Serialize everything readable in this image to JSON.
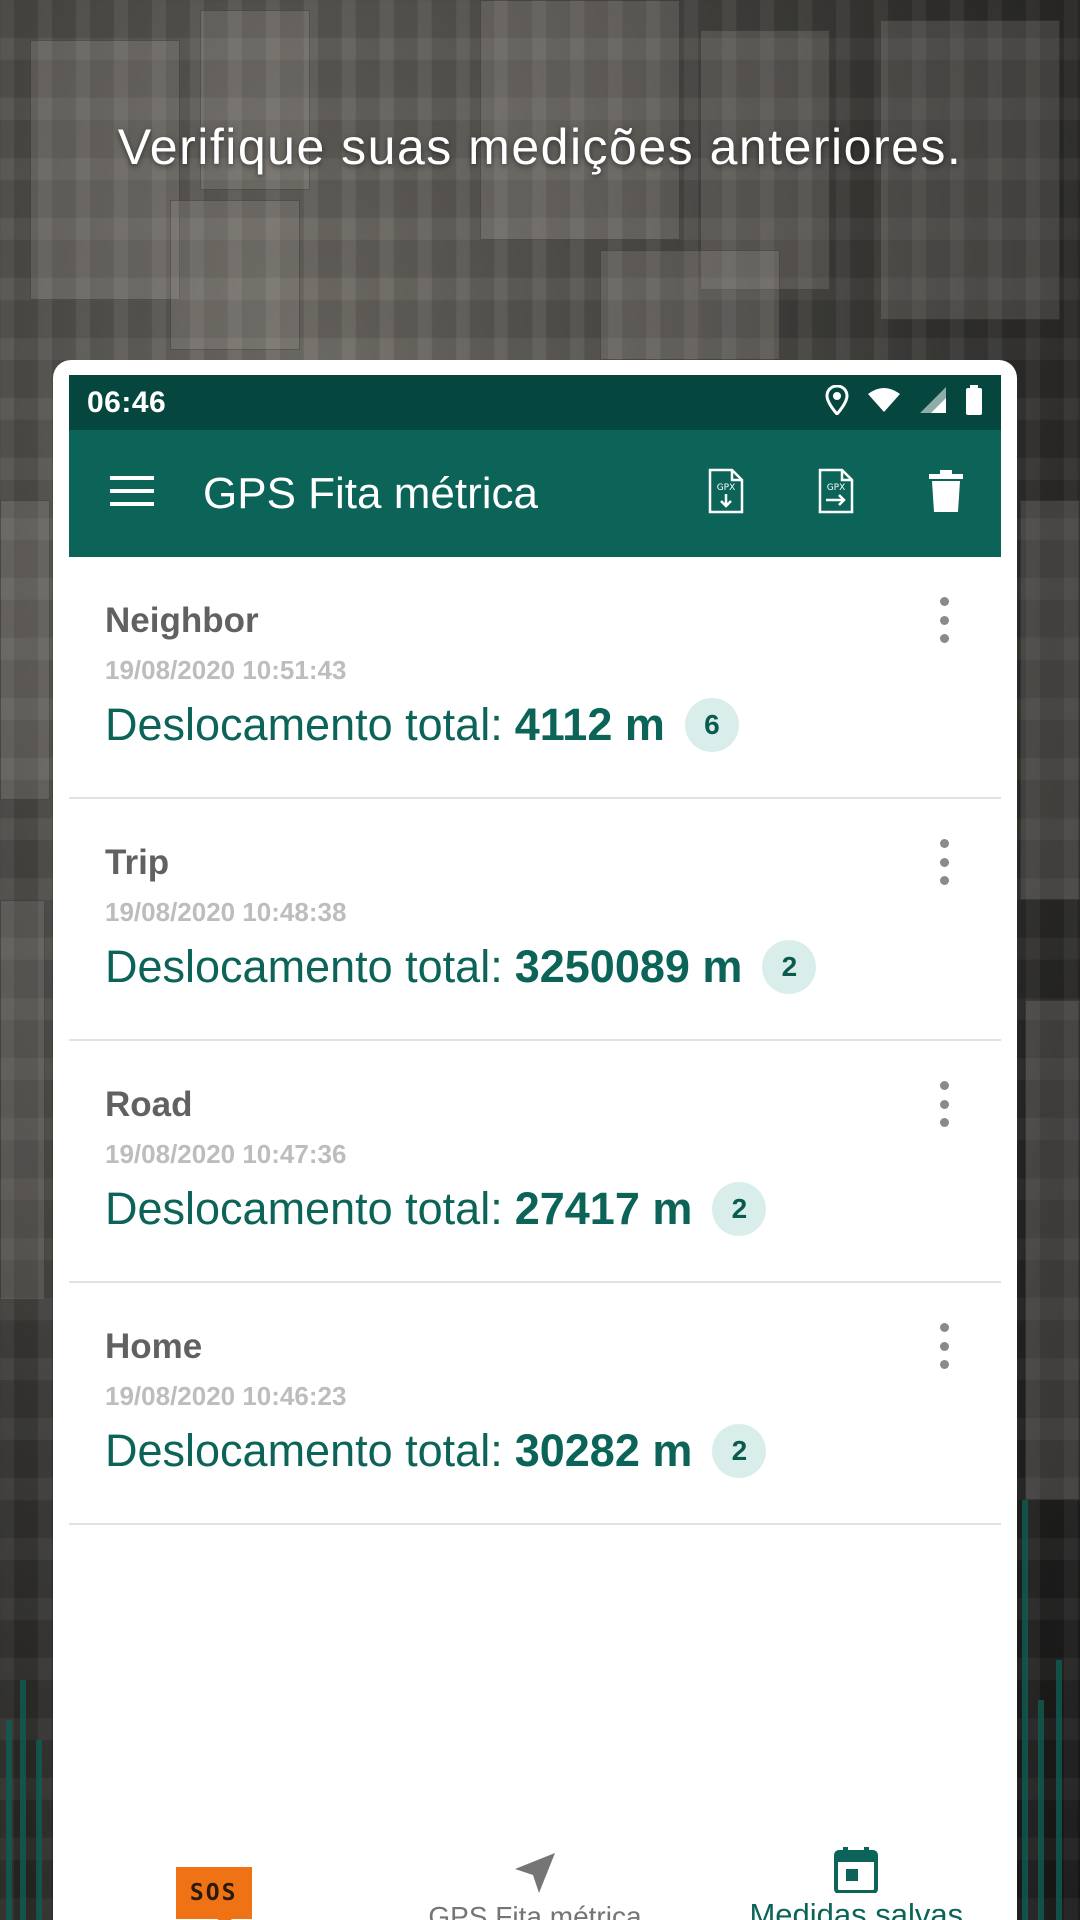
{
  "tagline": "Verifique suas medições anteriores.",
  "status_bar": {
    "time": "06:46"
  },
  "app_bar": {
    "title": "GPS Fita métrica"
  },
  "list": {
    "items": [
      {
        "name": "Neighbor",
        "date": "19/08/2020 10:51:43",
        "total_label": "Deslocamento total:",
        "total_value": "4112 m",
        "count": "6"
      },
      {
        "name": "Trip",
        "date": "19/08/2020 10:48:38",
        "total_label": "Deslocamento total:",
        "total_value": "3250089 m",
        "count": "2"
      },
      {
        "name": "Road",
        "date": "19/08/2020 10:47:36",
        "total_label": "Deslocamento total:",
        "total_value": "27417 m",
        "count": "2"
      },
      {
        "name": "Home",
        "date": "19/08/2020 10:46:23",
        "total_label": "Deslocamento total:",
        "total_value": "30282 m",
        "count": "2"
      }
    ]
  },
  "bottom_nav": {
    "sos_text": "SOS",
    "measure_label": "GPS Fita métrica",
    "saved_label": "Medidas salvas"
  },
  "icons": {
    "menu": "hamburger-menu-icon",
    "gpx_download": "gpx-download-icon",
    "gpx_share": "gpx-share-icon",
    "delete": "trash-icon",
    "more": "more-vertical-icon",
    "navigate": "navigation-arrow-icon",
    "calendar": "calendar-icon",
    "location": "location-pin-icon",
    "wifi": "wifi-icon",
    "signal": "signal-icon",
    "battery": "battery-icon"
  },
  "colors": {
    "status_bar": "#05473f",
    "app_bar": "#0b6457",
    "accent_text": "#0b6457",
    "badge_bg": "#d9eeea",
    "sos": "#ef7214"
  }
}
